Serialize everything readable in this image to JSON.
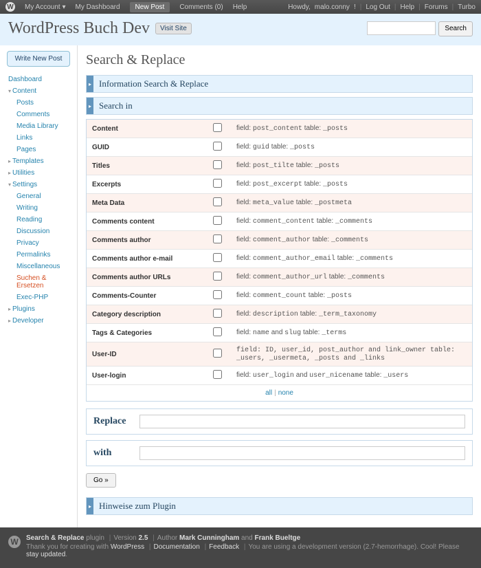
{
  "adminbar": {
    "my_account": "My Account ▾",
    "my_dashboard": "My Dashboard",
    "new_post": "New Post",
    "comments": "Comments (0)",
    "help": "Help",
    "howdy": "Howdy,",
    "username": "malo.conny",
    "logout": "Log Out",
    "help2": "Help",
    "forums": "Forums",
    "turbo": "Turbo"
  },
  "header": {
    "site_title": "WordPress Buch Dev",
    "visit_site": "Visit Site",
    "search_btn": "Search"
  },
  "sidebar": {
    "write_new": "Write New Post",
    "dashboard": "Dashboard",
    "content": "Content",
    "content_items": [
      "Posts",
      "Comments",
      "Media Library",
      "Links",
      "Pages"
    ],
    "templates": "Templates",
    "utilities": "Utilities",
    "settings": "Settings",
    "settings_items": [
      "General",
      "Writing",
      "Reading",
      "Discussion",
      "Privacy",
      "Permalinks",
      "Miscellaneous",
      "Suchen & Ersetzen",
      "Exec-PHP"
    ],
    "settings_current_index": 7,
    "plugins": "Plugins",
    "developer": "Developer"
  },
  "page": {
    "title": "Search & Replace",
    "panel_info": "Information Search & Replace",
    "panel_search": "Search in",
    "all": "all",
    "none": "none",
    "replace_label": "Replace",
    "with_label": "with",
    "go": "Go »",
    "panel_hinweise": "Hinweise zum Plugin",
    "rows": [
      {
        "label": "Content",
        "desc_pre": "field: ",
        "code": "post_content",
        "desc_mid": " table: ",
        "code2": "_posts"
      },
      {
        "label": "GUID",
        "desc_pre": "field: ",
        "code": "guid",
        "desc_mid": " table: ",
        "code2": "_posts"
      },
      {
        "label": "Titles",
        "desc_pre": "field: ",
        "code": "post_tilte",
        "desc_mid": " table: ",
        "code2": "_posts"
      },
      {
        "label": "Excerpts",
        "desc_pre": "field: ",
        "code": "post_excerpt",
        "desc_mid": " table: ",
        "code2": "_posts"
      },
      {
        "label": "Meta Data",
        "desc_pre": "field: ",
        "code": "meta_value",
        "desc_mid": " table: ",
        "code2": "_postmeta"
      },
      {
        "label": "Comments content",
        "desc_pre": "field: ",
        "code": "comment_content",
        "desc_mid": " table: ",
        "code2": "_comments"
      },
      {
        "label": "Comments author",
        "desc_pre": "field: ",
        "code": "comment_author",
        "desc_mid": " table: ",
        "code2": "_comments"
      },
      {
        "label": "Comments author e-mail",
        "desc_pre": "field: ",
        "code": "comment_author_email",
        "desc_mid": " table: ",
        "code2": "_comments"
      },
      {
        "label": "Comments author URLs",
        "desc_pre": "field: ",
        "code": "comment_author_url",
        "desc_mid": " table: ",
        "code2": "_comments"
      },
      {
        "label": "Comments-Counter",
        "desc_pre": "field: ",
        "code": "comment_count",
        "desc_mid": " table: ",
        "code2": "_posts"
      },
      {
        "label": "Category description",
        "desc_pre": "field: ",
        "code": "description",
        "desc_mid": " table: ",
        "code2": "_term_taxonomy"
      },
      {
        "label": "Tags & Categories",
        "desc_pre": "field: ",
        "code": "name",
        "desc_mid": " and ",
        "code2": "slug",
        "desc_post": " table: ",
        "code3": "_terms"
      },
      {
        "label": "User-ID",
        "desc_full": "field: ID, user_id, post_author and link_owner table: _users, _usermeta, _posts and _links"
      },
      {
        "label": "User-login",
        "desc_pre": "field: ",
        "code": "user_login",
        "desc_mid": " and ",
        "code2": "user_nicename",
        "desc_post": " table: ",
        "code3": "_users"
      }
    ]
  },
  "footer": {
    "l1_a": "Search & Replace",
    "l1_b": " plugin",
    "l1_c": "Version ",
    "l1_ver": "2.5",
    "l1_d": "Author ",
    "l1_auth1": "Mark Cunningham",
    "l1_and": " and ",
    "l1_auth2": "Frank Bueltge",
    "l2_a": "Thank you for creating with ",
    "l2_wp": "WordPress",
    "l2_doc": "Documentation",
    "l2_fb": "Feedback",
    "l2_b": "You are using a development version (2.7-hemorrhage). Cool! Please ",
    "l2_stay": "stay updated",
    "l2_c": "."
  }
}
